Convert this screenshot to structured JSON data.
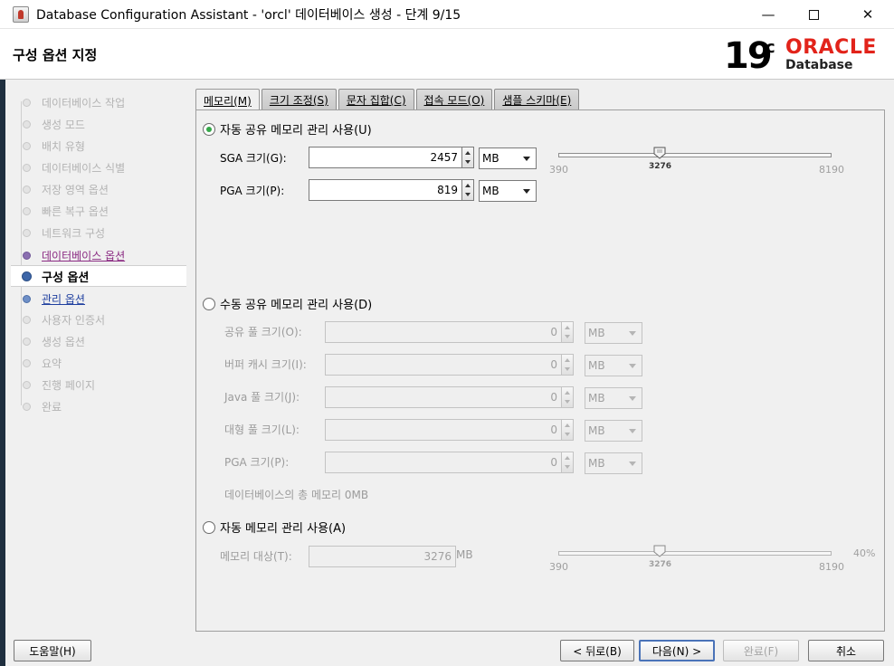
{
  "window": {
    "title": "Database Configuration Assistant - 'orcl' 데이터베이스 생성 - 단계 9/15",
    "minimize": "—",
    "close": "✕"
  },
  "header": {
    "page_title": "구성 옵션 지정",
    "logo_version": "19",
    "logo_c": "c",
    "logo_brand": "ORACLE",
    "logo_product": "Database"
  },
  "steps": [
    {
      "label": "데이터베이스 작업",
      "state": "inactive"
    },
    {
      "label": "생성 모드",
      "state": "inactive"
    },
    {
      "label": "배치 유형",
      "state": "inactive"
    },
    {
      "label": "데이터베이스 식별",
      "state": "inactive"
    },
    {
      "label": "저장 영역 옵션",
      "state": "inactive"
    },
    {
      "label": "빠른 복구 옵션",
      "state": "inactive"
    },
    {
      "label": "네트워크 구성",
      "state": "inactive"
    },
    {
      "label": "데이터베이스 옵션",
      "state": "visited"
    },
    {
      "label": "구성 옵션",
      "state": "current"
    },
    {
      "label": "관리 옵션",
      "state": "link"
    },
    {
      "label": "사용자 인증서",
      "state": "inactive"
    },
    {
      "label": "생성 옵션",
      "state": "inactive"
    },
    {
      "label": "요약",
      "state": "inactive"
    },
    {
      "label": "진행 페이지",
      "state": "inactive"
    },
    {
      "label": "완료",
      "state": "inactive"
    }
  ],
  "tabs": [
    {
      "label": "메모리(M)",
      "active": true
    },
    {
      "label": "크기 조정(S)",
      "active": false
    },
    {
      "label": "문자 집합(C)",
      "active": false
    },
    {
      "label": "접속 모드(O)",
      "active": false
    },
    {
      "label": "샘플 스키마(E)",
      "active": false
    }
  ],
  "memory": {
    "auto_shared": {
      "label": "자동 공유 메모리 관리 사용(U)",
      "selected": true,
      "sga_label": "SGA 크기(G):",
      "sga_value": "2457",
      "sga_unit": "MB",
      "pga_label": "PGA 크기(P):",
      "pga_value": "819",
      "pga_unit": "MB",
      "slider": {
        "min": "390",
        "max": "8190",
        "current": "3276",
        "fraction": 0.372
      }
    },
    "manual_shared": {
      "label": "수동 공유 메모리 관리 사용(D)",
      "selected": false,
      "fields": [
        {
          "label": "공유 풀 크기(O):",
          "value": "0",
          "unit": "MB"
        },
        {
          "label": "버퍼 캐시 크기(I):",
          "value": "0",
          "unit": "MB"
        },
        {
          "label": "Java 풀 크기(J):",
          "value": "0",
          "unit": "MB"
        },
        {
          "label": "대형 풀 크기(L):",
          "value": "0",
          "unit": "MB"
        },
        {
          "label": "PGA 크기(P):",
          "value": "0",
          "unit": "MB"
        }
      ],
      "total_note": "데이터베이스의 총 메모리 0MB"
    },
    "auto_memory": {
      "label": "자동 메모리 관리 사용(A)",
      "selected": false,
      "target_label": "메모리 대상(T):",
      "target_value": "3276",
      "target_unit": "MB",
      "slider": {
        "min": "390",
        "max": "8190",
        "current": "3276",
        "percent": "40%",
        "fraction": 0.372
      }
    }
  },
  "buttons": {
    "help": "도움말(H)",
    "back": "< 뒤로(B)",
    "next": "다음(N) >",
    "finish": "완료(F)",
    "cancel": "취소"
  },
  "colors": {
    "radio_checked": "#36a84a",
    "oracle_red": "#e2231a",
    "current_step": "#3d66a8"
  }
}
